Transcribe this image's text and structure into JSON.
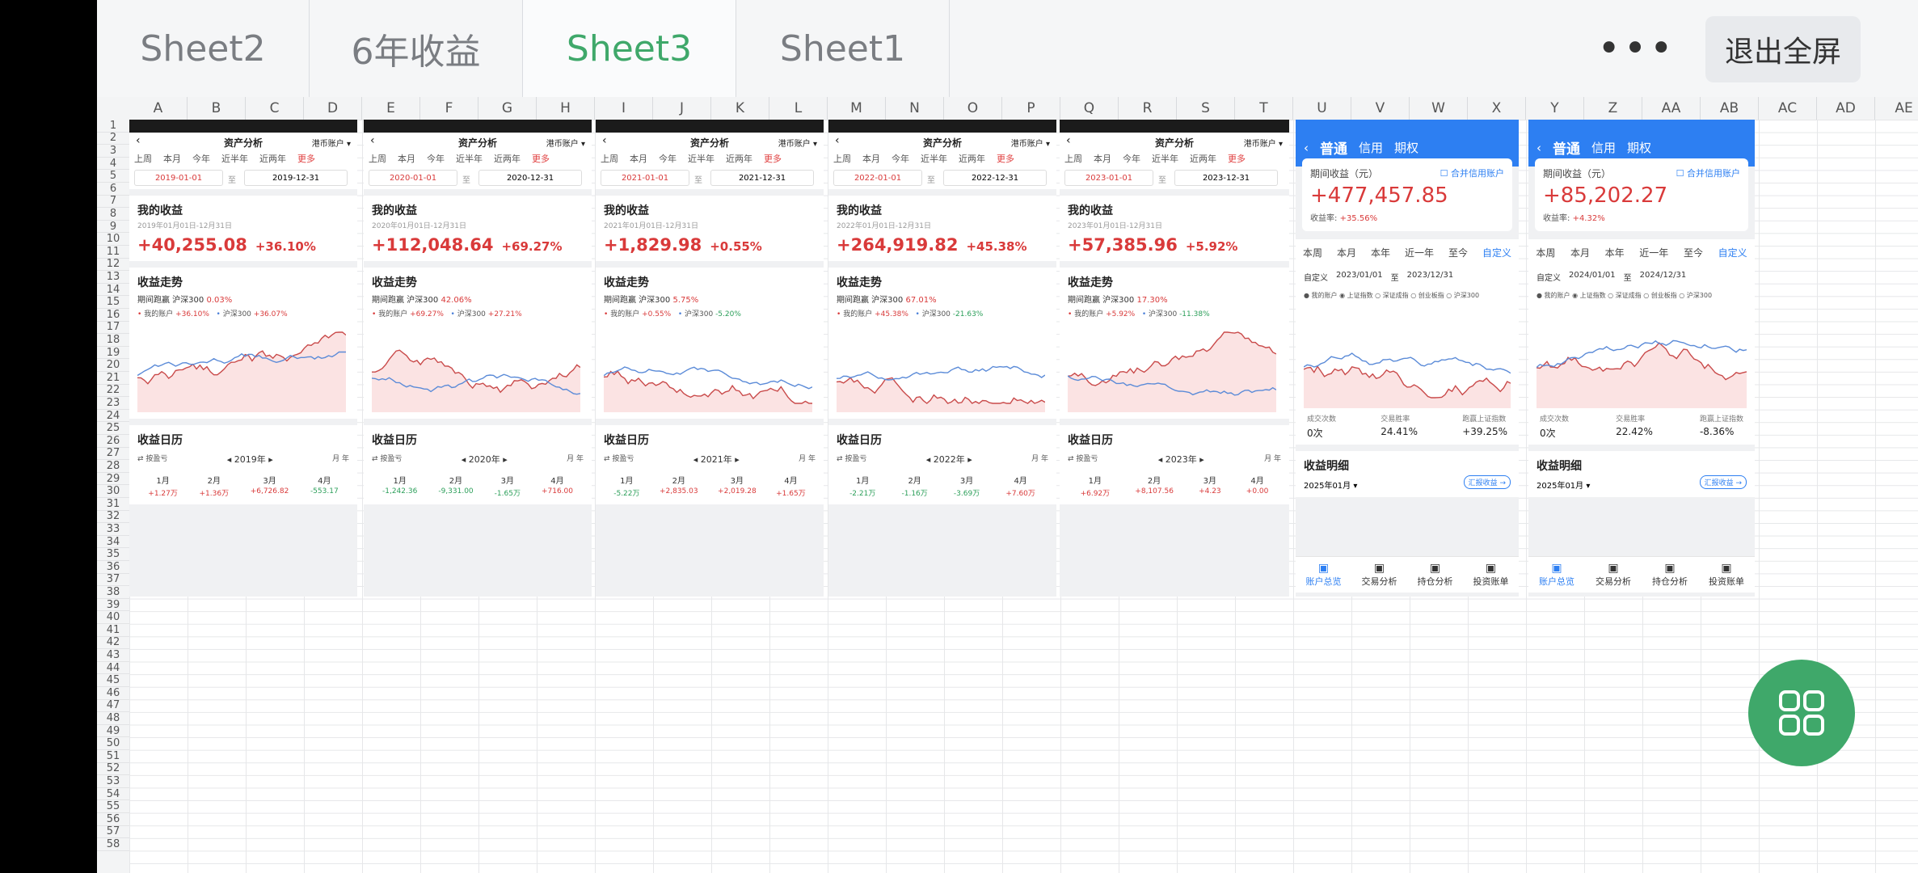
{
  "tabs": [
    {
      "label": "Sheet2",
      "active": false
    },
    {
      "label": "6年收益",
      "active": false
    },
    {
      "label": "Sheet3",
      "active": true
    },
    {
      "label": "Sheet1",
      "active": false
    }
  ],
  "more_label": "•••",
  "exit_fullscreen": "退出全屏",
  "columns": [
    "A",
    "B",
    "C",
    "D",
    "E",
    "F",
    "G",
    "H",
    "I",
    "J",
    "K",
    "L",
    "M",
    "N",
    "O",
    "P",
    "Q",
    "R",
    "S",
    "T",
    "U",
    "V",
    "W",
    "X",
    "Y",
    "Z",
    "AA",
    "AB",
    "AC",
    "AD",
    "AE"
  ],
  "row_count": 58,
  "common": {
    "title": "资产分析",
    "account": "港币账户 ▾",
    "periods": [
      "上周",
      "本月",
      "今年",
      "近半年",
      "近两年",
      "更多"
    ],
    "to": "至",
    "my_income": "我的收益",
    "trend": "收益走势",
    "bench_prefix": "期间跑赢 沪深300",
    "legend_mine": "我的账户",
    "legend_hs": "沪深300",
    "calendar": "收益日历",
    "cal_left": "⇄ 按盈亏",
    "cal_right": "月  年",
    "months": [
      "1月",
      "2月",
      "3月",
      "4月"
    ]
  },
  "years": [
    {
      "start": "2019-01-01",
      "end": "2019-12-31",
      "range": "2019年01月01日-12月31日",
      "value": "+40,255.08",
      "pct": "+36.10%",
      "bench": "0.03%",
      "mine": "+36.10%",
      "hs": "+36.07%",
      "year": "2019年",
      "m": [
        "+1.27万",
        "+1.36万",
        "+6,726.82",
        "-553.17"
      ]
    },
    {
      "start": "2020-01-01",
      "end": "2020-12-31",
      "range": "2020年01月01日-12月31日",
      "value": "+112,048.64",
      "pct": "+69.27%",
      "bench": "42.06%",
      "mine": "+69.27%",
      "hs": "+27.21%",
      "year": "2020年",
      "m": [
        "-1,242.36",
        "-9,331.00",
        "-1.65万",
        "+716.00"
      ]
    },
    {
      "start": "2021-01-01",
      "end": "2021-12-31",
      "range": "2021年01月01日-12月31日",
      "value": "+1,829.98",
      "pct": "+0.55%",
      "bench": "5.75%",
      "mine": "+0.55%",
      "hs": "-5.20%",
      "year": "2021年",
      "m": [
        "-5.22万",
        "+2,835.03",
        "+2,019.28",
        "+1.65万"
      ]
    },
    {
      "start": "2022-01-01",
      "end": "2022-12-31",
      "range": "2022年01月01日-12月31日",
      "value": "+264,919.82",
      "pct": "+45.38%",
      "bench": "67.01%",
      "mine": "+45.38%",
      "hs": "-21.63%",
      "year": "2022年",
      "m": [
        "-2.21万",
        "-1.16万",
        "-3.69万",
        "+7.60万"
      ]
    },
    {
      "start": "2023-01-01",
      "end": "2023-12-31",
      "range": "2023年01月01日-12月31日",
      "value": "+57,385.96",
      "pct": "+5.92%",
      "bench": "17.30%",
      "mine": "+5.92%",
      "hs": "-11.38%",
      "year": "2023年",
      "m": [
        "+6.92万",
        "+8,107.56",
        "+4.23",
        "+0.00"
      ]
    }
  ],
  "app": {
    "nav": [
      "普通",
      "信用",
      "期权"
    ],
    "period_label": "期间收益（元）",
    "merge": "合并信用账户",
    "rate_label": "收益率:",
    "rtabs": [
      "本周",
      "本月",
      "本年",
      "近一年",
      "至今",
      "自定义"
    ],
    "custom": "自定义",
    "legend": "● 我的账户  ◉ 上证指数  ○ 深证成指  ○ 创业板指  ○ 沪深300",
    "stat_labels": [
      "成交次数",
      "交易胜率",
      "跑赢上证指数"
    ],
    "detail_title": "收益明细",
    "detail_month": "2025年01月 ▾",
    "detail_btn": "汇报收益 →",
    "bottom": [
      "账户总览",
      "交易分析",
      "持仓分析",
      "投资账单"
    ],
    "shots": [
      {
        "value": "+477,457.85",
        "rate": "+35.56%",
        "start": "2023/01/01",
        "end": "2023/12/31",
        "stats": [
          "0次",
          "24.41%",
          "+39.25%"
        ]
      },
      {
        "value": "+85,202.27",
        "rate": "+4.32%",
        "start": "2024/01/01",
        "end": "2024/12/31",
        "stats": [
          "0次",
          "22.42%",
          "-8.36%"
        ]
      }
    ]
  },
  "colors": {
    "accent": "#3fa86a",
    "red": "#d93a3a",
    "green": "#2c9f5a",
    "blue": "#2d7ff2"
  }
}
